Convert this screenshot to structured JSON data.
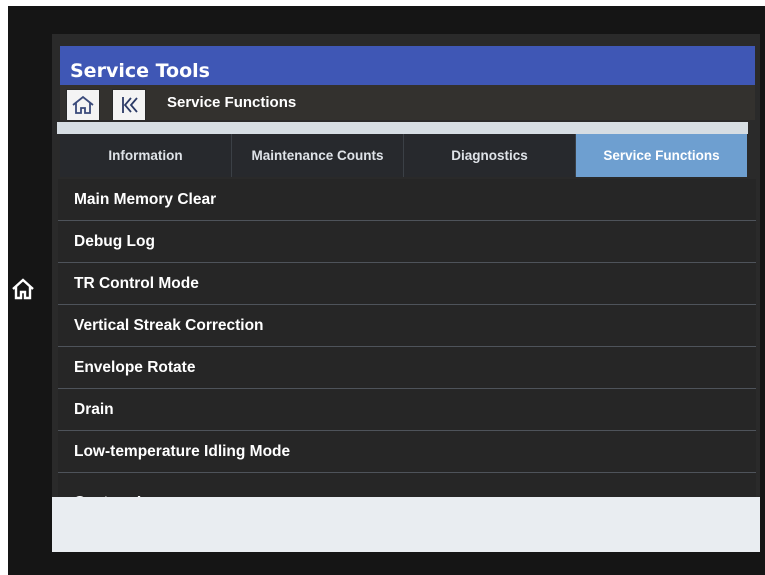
{
  "header": {
    "title": "Service Tools"
  },
  "breadcrumb": {
    "home_icon": "home-icon",
    "back_icon": "back-icon",
    "label": "Service Functions"
  },
  "tabs": [
    {
      "label": "Information",
      "active": false
    },
    {
      "label": "Maintenance Counts",
      "active": false
    },
    {
      "label": "Diagnostics",
      "active": false
    },
    {
      "label": "Service Functions",
      "active": true
    }
  ],
  "list": {
    "items": [
      "Main Memory Clear",
      "Debug Log",
      "TR Control Mode",
      "Vertical Streak Correction",
      "Envelope Rotate",
      "Drain",
      "Low-temperature Idling Mode",
      "Capture Log"
    ]
  },
  "bezel": {
    "home_icon": "home-icon"
  },
  "colors": {
    "title_bar": "#3f57b5",
    "active_tab": "#6e9fd0",
    "list_bg": "#262626",
    "bezel": "#151515"
  }
}
